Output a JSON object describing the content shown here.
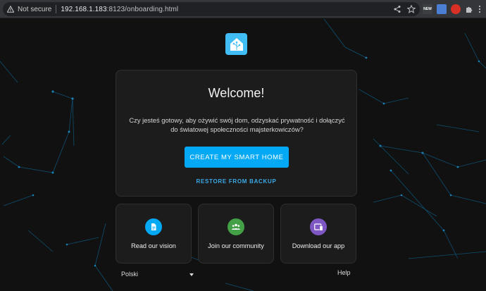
{
  "browser": {
    "security_label": "Not secure",
    "url_host": "192.168.1.183",
    "url_path": ":8123/onboarding.html",
    "ext_new_label": "NEW"
  },
  "welcome": {
    "title": "Welcome!",
    "text": "Czy jesteś gotowy, aby ożywić swój dom, odzyskać prywatność i dołączyć do światowej społeczności majsterkowiczów?",
    "create_button": "CREATE MY SMART HOME",
    "restore_button": "RESTORE FROM BACKUP"
  },
  "links": [
    {
      "label": "Read our vision",
      "icon": "document-icon",
      "color": "#03a9f4"
    },
    {
      "label": "Join our community",
      "icon": "group-icon",
      "color": "#43a047"
    },
    {
      "label": "Download our app",
      "icon": "devices-icon",
      "color": "#7e57c2"
    }
  ],
  "footer": {
    "language": "Polski",
    "help": "Help"
  },
  "colors": {
    "accent": "#03a9f4",
    "background": "#111111",
    "card": "#1c1c1c"
  }
}
